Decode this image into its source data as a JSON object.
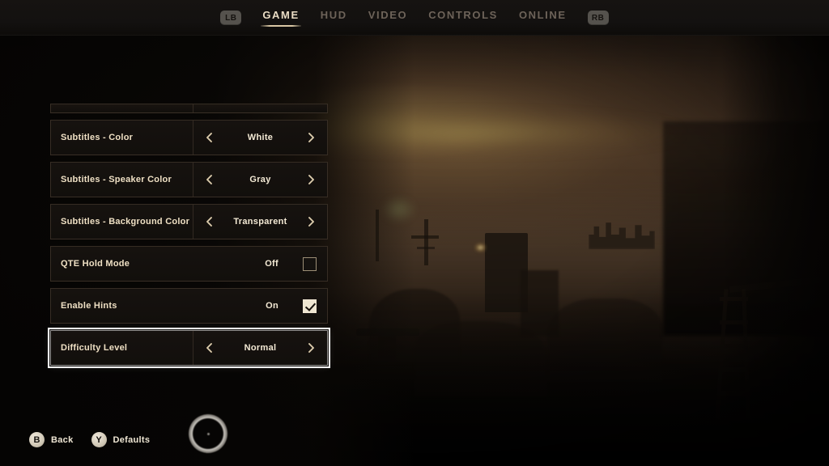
{
  "topbar": {
    "left_bumper": "LB",
    "right_bumper": "RB",
    "tabs": [
      {
        "label": "GAME",
        "active": true
      },
      {
        "label": "HUD",
        "active": false
      },
      {
        "label": "VIDEO",
        "active": false
      },
      {
        "label": "CONTROLS",
        "active": false
      },
      {
        "label": "ONLINE",
        "active": false
      }
    ]
  },
  "settings": {
    "rows": [
      {
        "label": "Subtitles - Color",
        "value": "White",
        "type": "selector",
        "selected": false
      },
      {
        "label": "Subtitles - Speaker Color",
        "value": "Gray",
        "type": "selector",
        "selected": false
      },
      {
        "label": "Subtitles - Background Color",
        "value": "Transparent",
        "type": "selector",
        "selected": false
      },
      {
        "label": "QTE Hold Mode",
        "value": "Off",
        "type": "toggle",
        "checked": false,
        "selected": false
      },
      {
        "label": "Enable Hints",
        "value": "On",
        "type": "toggle",
        "checked": true,
        "selected": false
      },
      {
        "label": "Difficulty Level",
        "value": "Normal",
        "type": "selector",
        "selected": true
      }
    ]
  },
  "prompts": [
    {
      "button": "B",
      "label": "Back"
    },
    {
      "button": "Y",
      "label": "Defaults"
    }
  ],
  "colors": {
    "active_tab": "#e9dcc4",
    "inactive_tab": "#6d6359",
    "row_label": "#efe0c4",
    "row_value": "#f4ead5",
    "selection_outline": "#ffffff",
    "bumper_bg": "#55524d"
  }
}
